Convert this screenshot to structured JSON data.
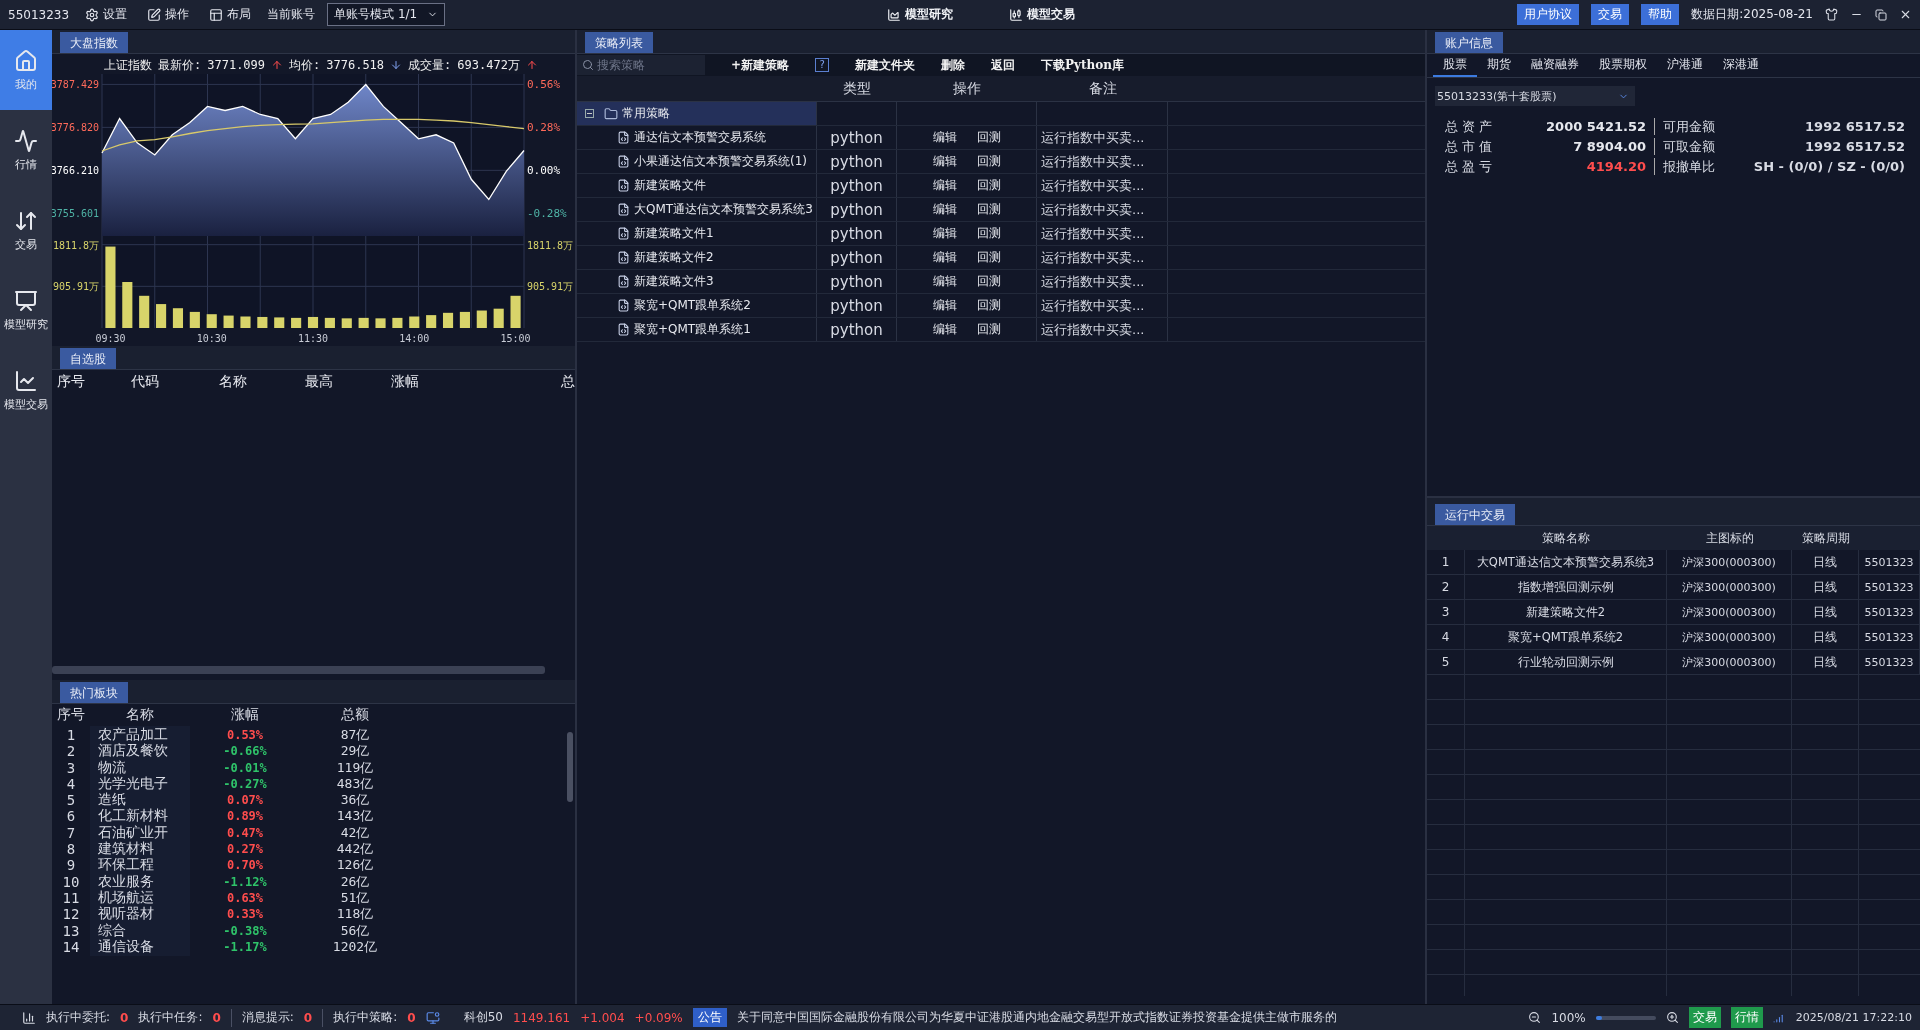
{
  "top_bar": {
    "account": "55013233",
    "menu": [
      {
        "label": "设置"
      },
      {
        "label": "操作"
      },
      {
        "label": "布局"
      }
    ],
    "account_label": "当前账号",
    "account_mode": "单账号模式 1/1",
    "center_tabs": [
      {
        "label": "模型研究",
        "selected": false
      },
      {
        "label": "模型交易",
        "selected": false
      }
    ],
    "buttons": [
      "用户协议",
      "交易",
      "帮助"
    ],
    "data_date": "数据日期:2025-08-21"
  },
  "sidebar": {
    "items": [
      {
        "label": "我的",
        "selected": true
      },
      {
        "label": "行情",
        "selected": false
      },
      {
        "label": "交易",
        "selected": false
      },
      {
        "label": "模型研究",
        "selected": false
      },
      {
        "label": "模型交易",
        "selected": false
      }
    ]
  },
  "index_panel": {
    "tab": "大盘指数",
    "name": "上证指数",
    "info": [
      {
        "label": "最新价:",
        "value": "3771.099",
        "up": true
      },
      {
        "label": "均价:",
        "value": "3776.518",
        "up": false
      },
      {
        "label": "成交量:",
        "value": "693.472万",
        "up": true
      }
    ],
    "price": {
      "right_labels": [
        {
          "text": "0.56%",
          "color": "#ff6a5a"
        },
        {
          "text": "0.28%",
          "color": "#ff6a5a"
        },
        {
          "text": "0.00%",
          "color": "#ffffff"
        },
        {
          "text": "-0.28%",
          "color": "#4fb3a6"
        }
      ],
      "chart_data": {
        "type": "area",
        "grid": true,
        "ylim": [
          3750,
          3790
        ],
        "yticks": [
          {
            "value": 3755.601,
            "label": "3755.601"
          },
          {
            "value": 3766.21,
            "label": "3766.210"
          },
          {
            "value": 3776.82,
            "label": "3776.820"
          },
          {
            "value": 3787.429,
            "label": "3787.429"
          }
        ],
        "series": [
          {
            "type": "area",
            "color": "#ffffff",
            "values": [
              3770.5,
              3779,
              3773,
              3770,
              3775,
              3778,
              3782,
              3781,
              3782,
              3780,
              3779,
              3774,
              3779,
              3780,
              3783,
              3787.4,
              3782,
              3778,
              3774,
              3775,
              3773,
              3764,
              3759,
              3766,
              3771.1
            ]
          },
          {
            "type": "line",
            "color": "#d8c96a",
            "values": [
              3771,
              3772.5,
              3773.5,
              3773.8,
              3774.5,
              3775.3,
              3776,
              3776.5,
              3777,
              3777.3,
              3777.5,
              3777.6,
              3777.7,
              3778,
              3778.3,
              3778.6,
              3778.8,
              3778.8,
              3778.8,
              3778.6,
              3778.4,
              3778,
              3777.5,
              3777,
              3776.5
            ]
          }
        ]
      }
    },
    "volume": {
      "right_labels": [
        {
          "text": "1811.8万"
        },
        {
          "text": "905.91万"
        }
      ],
      "chart_data": {
        "type": "bar",
        "grid": true,
        "ylim": [
          0,
          2000
        ],
        "yticks": [
          {
            "value": 905.91,
            "label": "905.91万"
          },
          {
            "value": 1811.8,
            "label": "1811.8万"
          }
        ],
        "categories": [
          "09:30",
          null,
          null,
          null,
          null,
          null,
          "10:30",
          null,
          null,
          null,
          null,
          null,
          "11:30",
          null,
          null,
          null,
          null,
          null,
          "14:00",
          null,
          null,
          null,
          null,
          null,
          "15:00"
        ],
        "series": [
          {
            "color": "#d8d46a",
            "values": [
              1770,
              1000,
              700,
              520,
              430,
              350,
              300,
              270,
              250,
              240,
              230,
              220,
              240,
              220,
              210,
              220,
              210,
              220,
              250,
              280,
              330,
              350,
              380,
              420,
              700
            ]
          }
        ]
      }
    }
  },
  "watchlist": {
    "tab": "自选股",
    "columns": [
      "序号",
      "代码",
      "名称",
      "最高",
      "涨幅",
      "总"
    ]
  },
  "hot_sectors": {
    "tab": "热门板块",
    "columns": [
      "序号",
      "名称",
      "涨幅",
      "总额"
    ],
    "rows": [
      {
        "no": "1",
        "name": "农产品加工",
        "change": "0.53%",
        "up": true,
        "amount": "87亿"
      },
      {
        "no": "2",
        "name": "酒店及餐饮",
        "change": "-0.66%",
        "up": false,
        "amount": "29亿"
      },
      {
        "no": "3",
        "name": "物流",
        "change": "-0.01%",
        "up": false,
        "amount": "119亿"
      },
      {
        "no": "4",
        "name": "光学光电子",
        "change": "-0.27%",
        "up": false,
        "amount": "483亿"
      },
      {
        "no": "5",
        "name": "造纸",
        "change": "0.07%",
        "up": true,
        "amount": "36亿"
      },
      {
        "no": "6",
        "name": "化工新材料",
        "change": "0.89%",
        "up": true,
        "amount": "143亿"
      },
      {
        "no": "7",
        "name": "石油矿业开",
        "change": "0.47%",
        "up": true,
        "amount": "42亿"
      },
      {
        "no": "8",
        "name": "建筑材料",
        "change": "0.27%",
        "up": true,
        "amount": "442亿"
      },
      {
        "no": "9",
        "name": "环保工程",
        "change": "0.70%",
        "up": true,
        "amount": "126亿"
      },
      {
        "no": "10",
        "name": "农业服务",
        "change": "-1.12%",
        "up": false,
        "amount": "26亿"
      },
      {
        "no": "11",
        "name": "机场航运",
        "change": "0.63%",
        "up": true,
        "amount": "51亿"
      },
      {
        "no": "12",
        "name": "视听器材",
        "change": "0.33%",
        "up": true,
        "amount": "118亿"
      },
      {
        "no": "13",
        "name": "综合",
        "change": "-0.38%",
        "up": false,
        "amount": "56亿"
      },
      {
        "no": "14",
        "name": "通信设备",
        "change": "-1.17%",
        "up": false,
        "amount": "1202亿"
      }
    ]
  },
  "strategy_panel": {
    "tab": "策略列表",
    "search": {
      "placeholder": "搜索策略"
    },
    "toolbar": [
      {
        "kind": "text",
        "label": "+新建策略"
      },
      {
        "kind": "help",
        "label": "?"
      },
      {
        "kind": "text",
        "label": "新建文件夹"
      },
      {
        "kind": "text",
        "label": "删除"
      },
      {
        "kind": "text",
        "label": "返回"
      },
      {
        "kind": "text",
        "label": "下载Python库"
      }
    ],
    "columns": [
      "类型",
      "操作",
      "备注"
    ],
    "tree": [
      {
        "label": "常用策略",
        "expanded": true,
        "selected": true,
        "children": [
          {
            "label": "通达信文本预警交易系统",
            "type": "python",
            "actions": [
              "编辑",
              "回测"
            ],
            "note": "运行指数中买卖..."
          },
          {
            "label": "小果通达信文本预警交易系统(1)",
            "type": "python",
            "actions": [
              "编辑",
              "回测"
            ],
            "note": "运行指数中买卖..."
          },
          {
            "label": "新建策略文件",
            "type": "python",
            "actions": [
              "编辑",
              "回测"
            ],
            "note": "运行指数中买卖..."
          },
          {
            "label": "大QMT通达信文本预警交易系统3",
            "type": "python",
            "actions": [
              "编辑",
              "回测"
            ],
            "note": "运行指数中买卖..."
          },
          {
            "label": "新建策略文件1",
            "type": "python",
            "actions": [
              "编辑",
              "回测"
            ],
            "note": "运行指数中买卖..."
          },
          {
            "label": "新建策略文件2",
            "type": "python",
            "actions": [
              "编辑",
              "回测"
            ],
            "note": "运行指数中买卖..."
          },
          {
            "label": "新建策略文件3",
            "type": "python",
            "actions": [
              "编辑",
              "回测"
            ],
            "note": "运行指数中买卖..."
          },
          {
            "label": "聚宽+QMT跟单系统2",
            "type": "python",
            "actions": [
              "编辑",
              "回测"
            ],
            "note": "运行指数中买卖..."
          },
          {
            "label": "聚宽+QMT跟单系统1",
            "type": "python",
            "actions": [
              "编辑",
              "回测"
            ],
            "note": "运行指数中买卖..."
          }
        ]
      }
    ]
  },
  "account_panel": {
    "tab": "账户信息",
    "tabs": [
      {
        "label": "股票",
        "selected": true
      },
      {
        "label": "期货",
        "selected": false
      },
      {
        "label": "融资融券",
        "selected": false
      },
      {
        "label": "股票期权",
        "selected": false
      },
      {
        "label": "沪港通",
        "selected": false
      },
      {
        "label": "深港通",
        "selected": false
      }
    ],
    "account_select": "55013233(第十套股票)",
    "left_stats": [
      {
        "label": "总 资 产",
        "value": "2000 5421.52",
        "gain": false
      },
      {
        "label": "总 市 值",
        "value": "7 8904.00",
        "gain": false
      },
      {
        "label": "总 盈 亏",
        "value": "4194.20",
        "gain": true
      }
    ],
    "right_stats": [
      {
        "label": "可用金额",
        "value": "1992 6517.52"
      },
      {
        "label": "可取金额",
        "value": "1992 6517.52"
      },
      {
        "label": "报撤单比",
        "value": "SH - (0/0) / SZ - (0/0)"
      }
    ]
  },
  "running_trades": {
    "tab": "运行中交易",
    "columns": {
      "name": "策略名称",
      "symbol": "主图标的",
      "period": "策略周期"
    },
    "rows": [
      {
        "no": "1",
        "name": "大QMT通达信文本预警交易系统3",
        "symbol": "沪深300(000300)",
        "period": "日线",
        "column_5": "5501323"
      },
      {
        "no": "2",
        "name": "指数增强回测示例",
        "symbol": "沪深300(000300)",
        "period": "日线",
        "column_5": "5501323"
      },
      {
        "no": "3",
        "name": "新建策略文件2",
        "symbol": "沪深300(000300)",
        "period": "日线",
        "column_5": "5501323"
      },
      {
        "no": "4",
        "name": "聚宽+QMT跟单系统2",
        "symbol": "沪深300(000300)",
        "period": "日线",
        "column_5": "5501323"
      },
      {
        "no": "5",
        "name": "行业轮动回测示例",
        "symbol": "沪深300(000300)",
        "period": "日线",
        "column_5": "5501323"
      }
    ]
  },
  "status_bar": {
    "counters": [
      {
        "label": "执行中委托:",
        "value": "0"
      },
      {
        "label": "执行中任务:",
        "value": "0"
      },
      {
        "label": "消息提示:",
        "value": "0"
      },
      {
        "label": "执行中策略:",
        "value": "0"
      }
    ],
    "index": {
      "name": "科创50",
      "price": "1149.161",
      "change": "+1.004",
      "percent": "+0.09%"
    },
    "notice": {
      "badge": "公告",
      "text": "关于同意中国国际金融股份有限公司为华夏中证港股通内地金融交易型开放式指数证券投资基金提供主做市服务的"
    },
    "zoom": {
      "text": "100%",
      "level": 0.1
    },
    "buttons": [
      "交易",
      "行情"
    ],
    "datetime": "2025/08/21 17:22:10"
  }
}
